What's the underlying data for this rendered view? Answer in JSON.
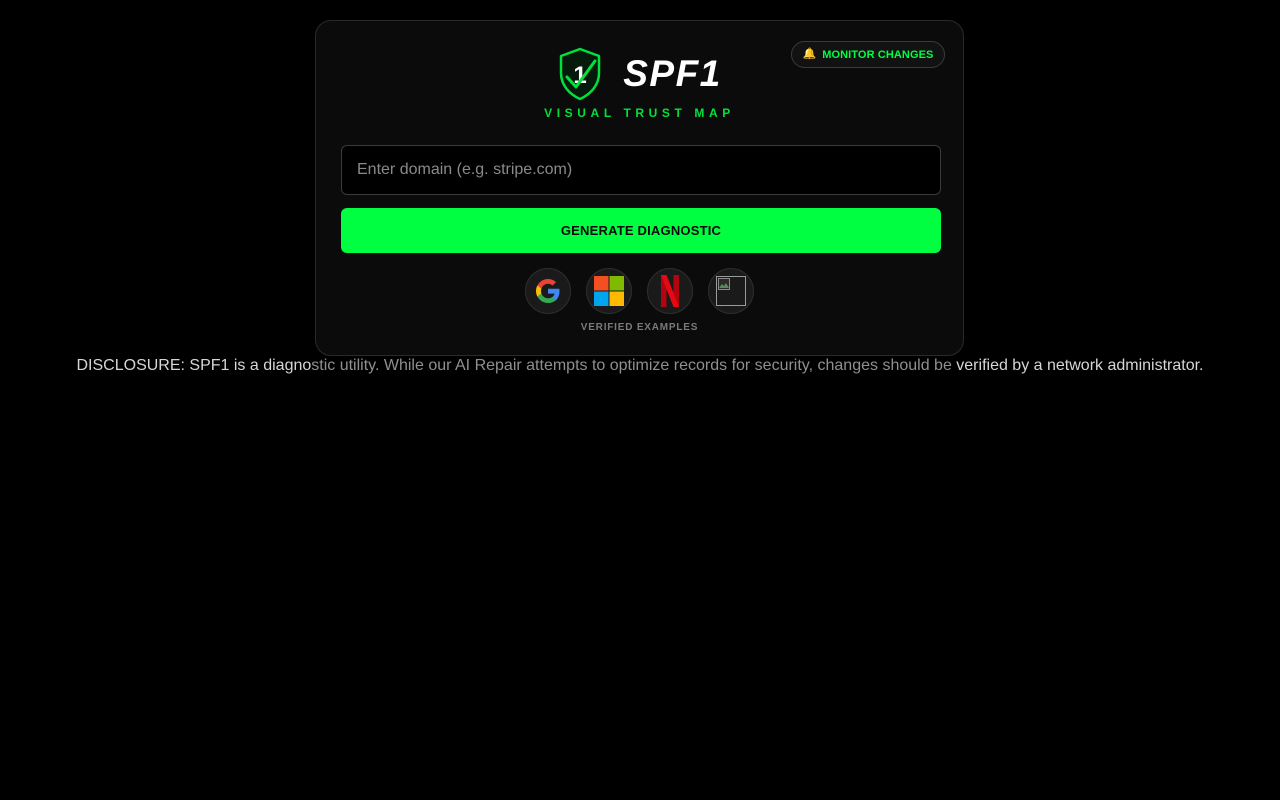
{
  "header": {
    "monitor_icon": "bell-icon",
    "monitor_label": "MONITOR CHANGES",
    "logo_icon": "shield-check-icon",
    "logo_number": "1",
    "title": "SPF1",
    "subtitle": "VISUAL TRUST MAP"
  },
  "form": {
    "domain_placeholder": "Enter domain (e.g. stripe.com)",
    "domain_value": "",
    "generate_label": "GENERATE DIAGNOSTIC"
  },
  "examples": {
    "items": [
      {
        "name": "google",
        "icon": "google-logo-icon"
      },
      {
        "name": "microsoft",
        "icon": "microsoft-logo-icon"
      },
      {
        "name": "netflix",
        "icon": "netflix-logo-icon"
      },
      {
        "name": "broken-image",
        "icon": "broken-image-icon"
      }
    ],
    "label": "VERIFIED EXAMPLES"
  },
  "disclosure": {
    "part1": "DISCLOSURE: SPF1 is a diagno",
    "part2": "stic utility. While our AI Repair attempts to optimize records for security, changes should be ",
    "part3": "verified by a network administrator."
  },
  "colors": {
    "accent": "#00ff41",
    "background": "#000000",
    "card": "#0b0b0b"
  }
}
